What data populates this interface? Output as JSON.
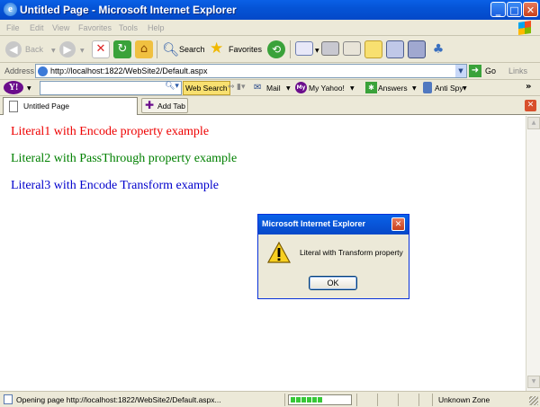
{
  "window": {
    "title": "Untitled Page - Microsoft Internet Explorer"
  },
  "menubar": {
    "items": [
      "File",
      "Edit",
      "View",
      "Favorites",
      "Tools",
      "Help"
    ]
  },
  "toolbar": {
    "back_label": "Back",
    "search_label": "Search",
    "favorites_label": "Favorites"
  },
  "addressbar": {
    "label": "Address",
    "url": "http://localhost:1822/WebSite2/Default.aspx",
    "go_label": "Go",
    "links_label": "Links"
  },
  "yahoo_toolbar": {
    "web_search_label": "Web Search",
    "mail_label": "Mail",
    "myyahoo_label": "My Yahoo!",
    "answers_label": "Answers",
    "antispy_label": "Anti Spy"
  },
  "tabs": {
    "active_tab": "Untitled Page",
    "add_tab_label": "Add Tab"
  },
  "page": {
    "literal1": {
      "text": "Literal1 with Encode property example",
      "color": "#ee0000"
    },
    "literal2": {
      "text": "Literal2 with PassThrough property example",
      "color": "#008000"
    },
    "literal3": {
      "text": "Literal3 with Encode Transform example",
      "color": "#0000cc"
    }
  },
  "dialog": {
    "title": "Microsoft Internet Explorer",
    "message": "Literal with Transform property",
    "ok_label": "OK"
  },
  "statusbar": {
    "text": "Opening page http://localhost:1822/WebSite2/Default.aspx...",
    "progress": 0.55,
    "zone": "Unknown Zone"
  }
}
